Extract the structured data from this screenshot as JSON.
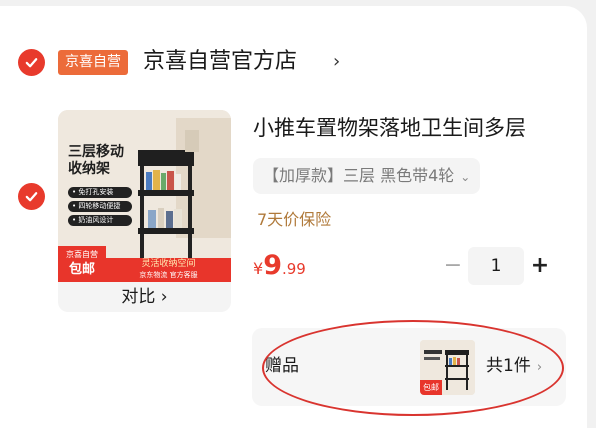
{
  "colors": {
    "accent": "#e83a2c",
    "shop_badge": "#ec6b3a",
    "guarantee": "#b07a3b",
    "annotation": "#d9342f"
  },
  "shop": {
    "badge": "京喜自营",
    "name": "京喜自营官方店",
    "chevron": "›",
    "checked": true
  },
  "item": {
    "checked": true,
    "image": {
      "title": "三层移动收纳架",
      "features": [
        "• 免打孔安装",
        "• 四轮移动便捷",
        "• 奶油风设计"
      ],
      "badge_top": "京喜自营",
      "badge_main": "包邮",
      "slogan": "灵活收纳空间",
      "strip_sub": "京东物流    官方客服"
    },
    "compare_label": "对比 ›",
    "title": "小推车置物架落地卫生间多层",
    "variant": "【加厚款】三层 黑色带4轮",
    "variant_chevron": "⌄",
    "guarantee": "7天价保险",
    "price": {
      "currency": "¥",
      "integer": "9",
      "decimal": ".99"
    },
    "quantity": {
      "minus": "−",
      "value": "1",
      "plus": "+"
    }
  },
  "gift": {
    "label": "赠品",
    "thumb_badge": "包邮",
    "count": "共1件",
    "chevron": "›"
  }
}
